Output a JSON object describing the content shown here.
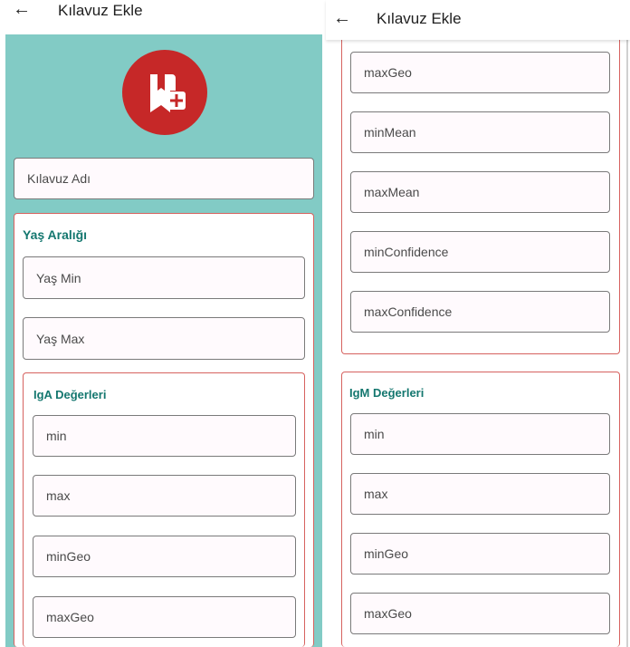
{
  "left": {
    "title": "Kılavuz Ekle",
    "name_field": "Kılavuz Adı",
    "age_section": {
      "title": "Yaş Aralığı",
      "min": "Yaş Min",
      "max": "Yaş Max"
    },
    "iga_section": {
      "title": "IgA Değerleri",
      "fields": [
        "min",
        "max",
        "minGeo",
        "maxGeo"
      ]
    }
  },
  "right": {
    "title": "Kılavuz Ekle",
    "prev_fields": [
      "maxGeo",
      "minMean",
      "maxMean",
      "minConfidence",
      "maxConfidence"
    ],
    "igm_section": {
      "title": "IgM Değerleri",
      "fields": [
        "min",
        "max",
        "minGeo",
        "maxGeo"
      ]
    }
  },
  "colors": {
    "teal": "#82cbc5",
    "red": "#c62828",
    "border": "#d6625f",
    "section_title": "#14776f"
  },
  "icons": {
    "back": "arrow-left-icon",
    "logo": "bookmark-add-icon"
  }
}
